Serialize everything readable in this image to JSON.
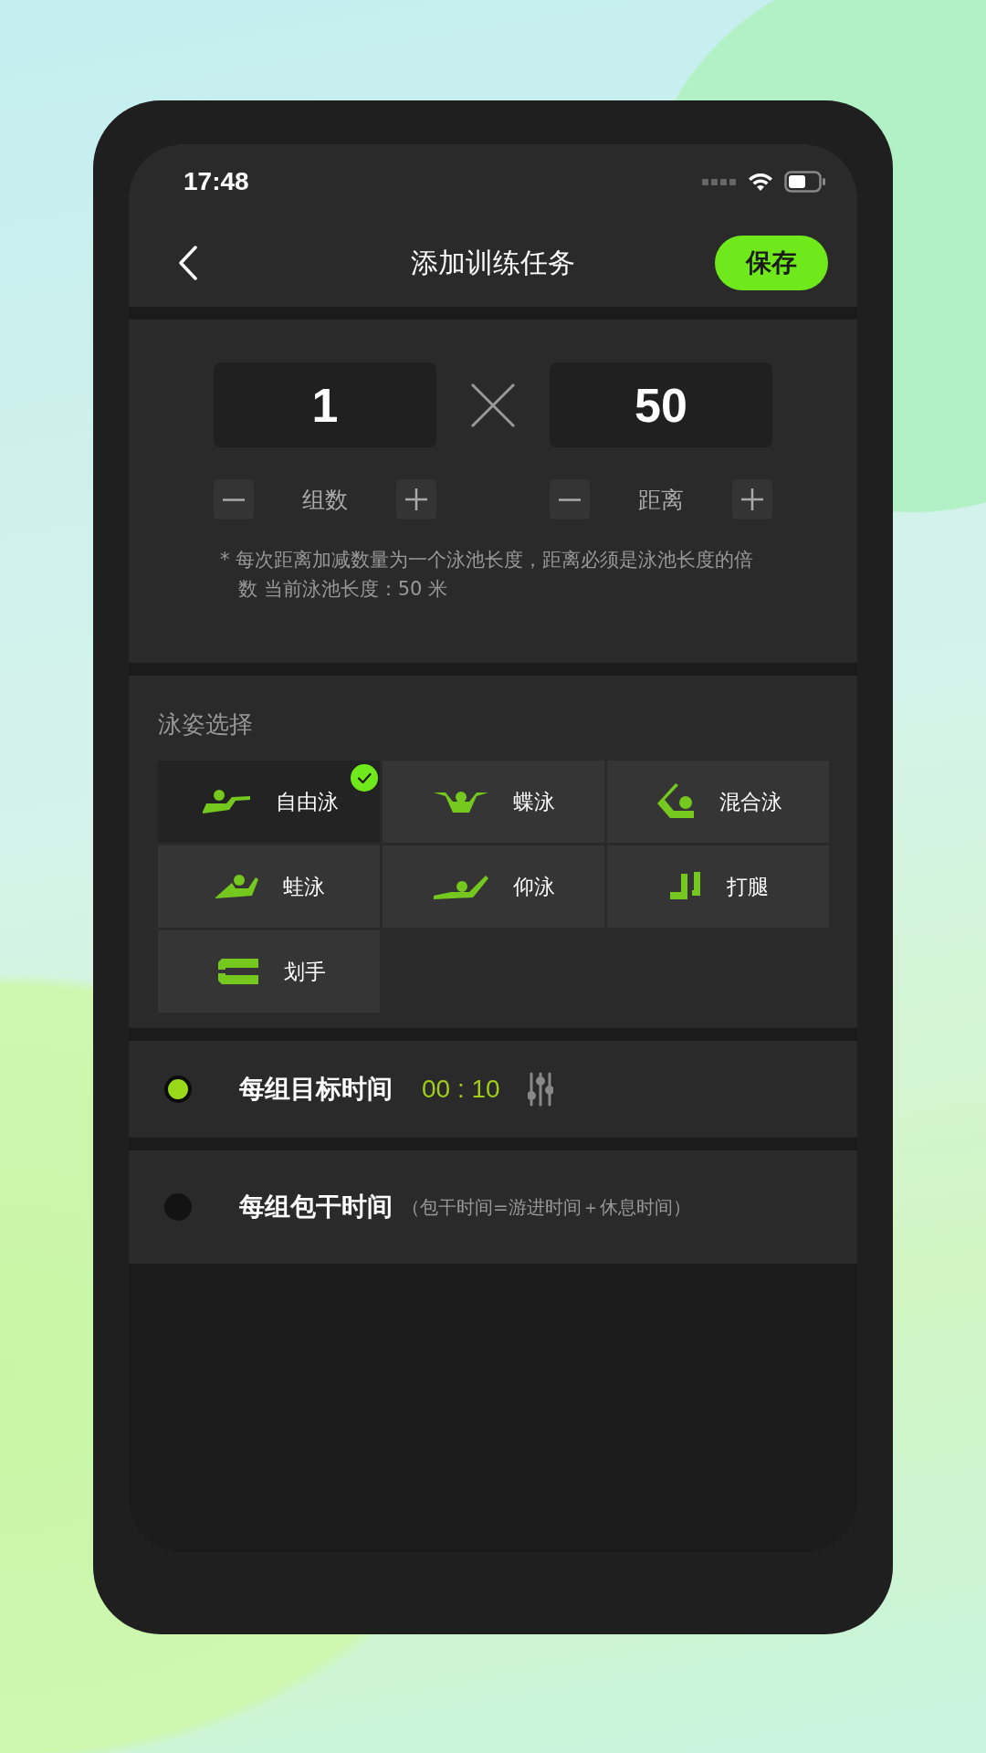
{
  "status_bar": {
    "time": "17:48"
  },
  "nav": {
    "title": "添加训练任务",
    "save_button": "保存"
  },
  "counters": [
    {
      "value": "1",
      "label": "组数"
    },
    {
      "value": "50",
      "label": "距离"
    }
  ],
  "note": "* 每次距离加减数量为一个泳池长度，距离必须是泳池长度的倍数 当前泳池长度：50 米",
  "strokes": {
    "title": "泳姿选择",
    "options": [
      {
        "label": "自由泳",
        "selected": true
      },
      {
        "label": "蝶泳",
        "selected": false
      },
      {
        "label": "混合泳",
        "selected": false
      },
      {
        "label": "蛙泳",
        "selected": false
      },
      {
        "label": "仰泳",
        "selected": false
      },
      {
        "label": "打腿",
        "selected": false
      },
      {
        "label": "划手",
        "selected": false
      }
    ]
  },
  "time_modes": [
    {
      "label": "每组目标时间",
      "value": "00 : 10",
      "selected": true
    },
    {
      "label": "每组包干时间",
      "hint": "（包干时间=游进时间＋休息时间）",
      "selected": false
    }
  ]
}
